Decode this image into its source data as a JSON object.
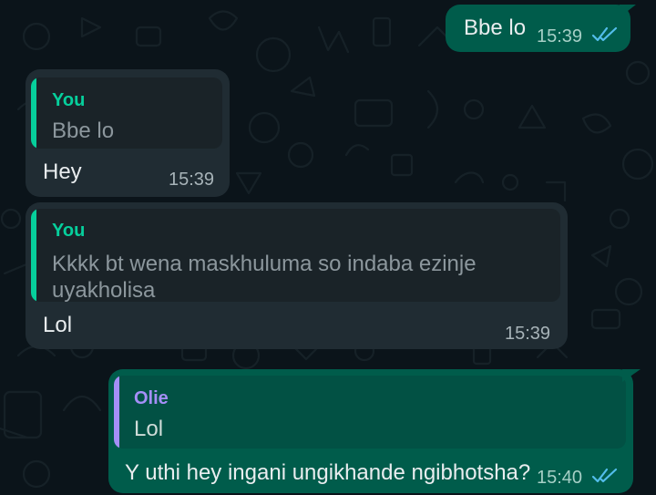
{
  "colors": {
    "chat_background": "#0b141a",
    "incoming_bubble": "#202c33",
    "outgoing_bubble": "#005c4b",
    "you_accent": "#06cf9c",
    "olie_accent": "#a58ff7",
    "read_ticks": "#53bdeb"
  },
  "messages": [
    {
      "direction": "outgoing",
      "text": "Bbe lo",
      "time": "15:39",
      "status": "read-double-tick-icon"
    },
    {
      "direction": "incoming",
      "quote": {
        "author": "You",
        "text": "Bbe lo"
      },
      "text": "Hey",
      "time": "15:39"
    },
    {
      "direction": "incoming",
      "quote": {
        "author": "You",
        "text_line1": "Kkkk bt wena maskhuluma so indaba ezinje",
        "text_line2": "uyakholisa"
      },
      "text": "Lol",
      "time": "15:39"
    },
    {
      "direction": "outgoing",
      "quote": {
        "author": "Olie",
        "text": "Lol"
      },
      "text": "Y uthi hey ingani ungikhande ngibhotsha?",
      "time": "15:40",
      "status": "read-double-tick-icon"
    }
  ]
}
